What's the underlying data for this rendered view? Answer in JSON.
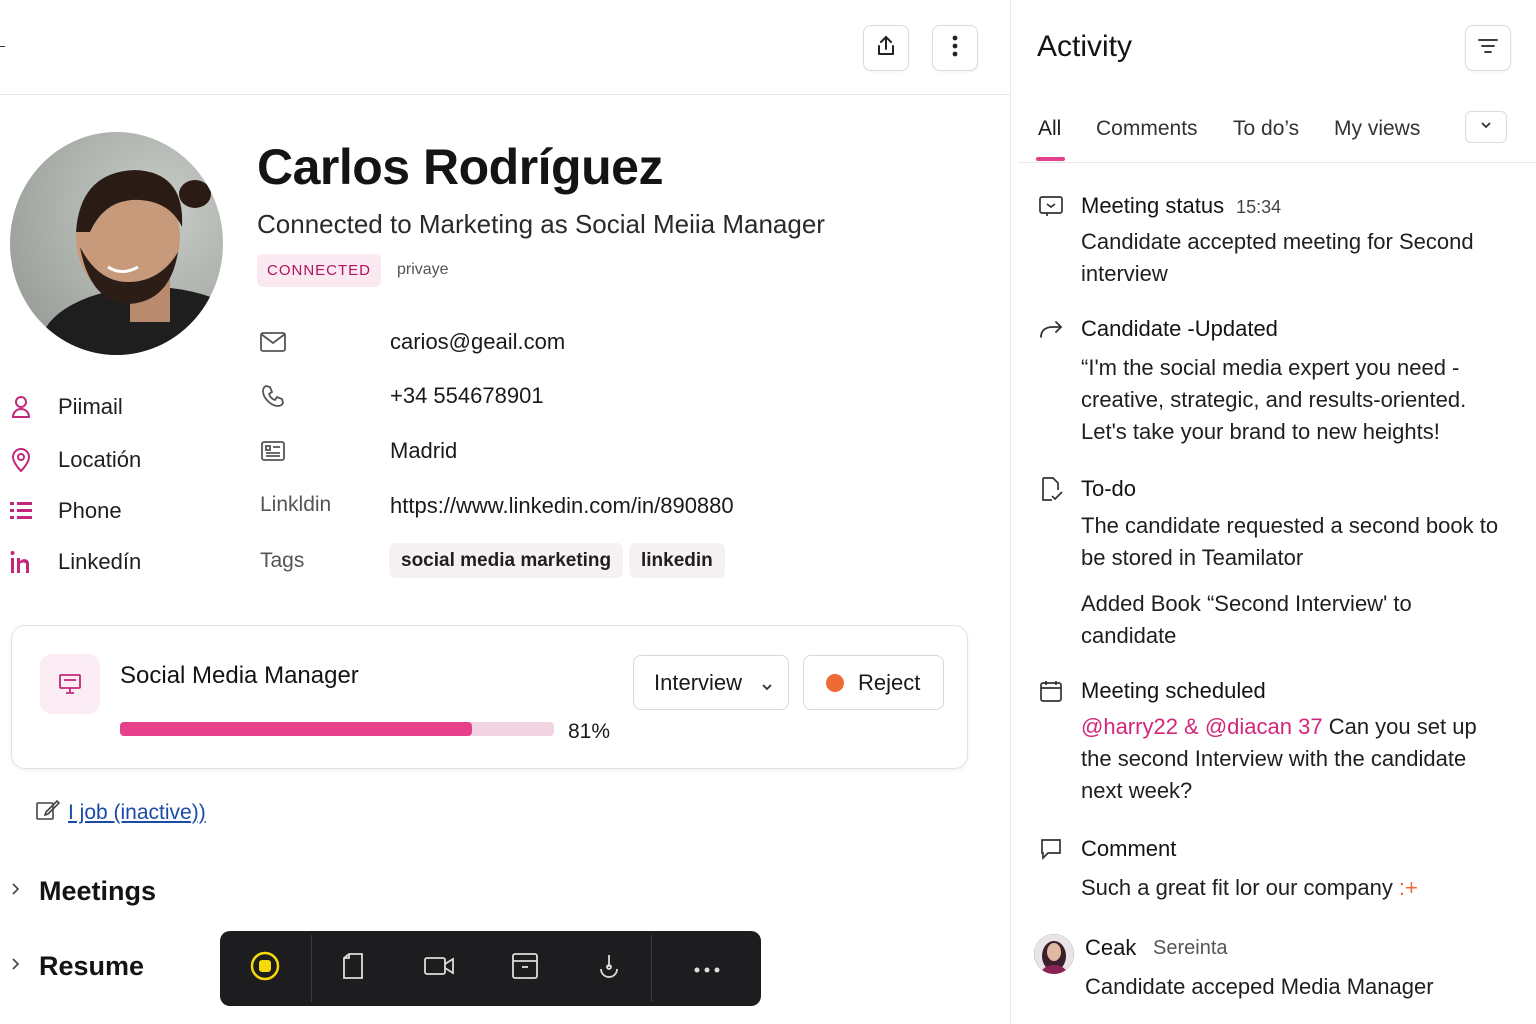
{
  "header": {
    "share_icon": "share-icon",
    "more_icon": "more-vertical-icon"
  },
  "profile": {
    "name": "Carlos Rodríguez",
    "subtitle": "Connected to Marketing as Social Meiia Manager",
    "status_badge": "CONNECTED",
    "privacy": "privaye"
  },
  "side_nav": [
    {
      "label": "Piimail",
      "icon": "user-icon"
    },
    {
      "label": "Locatión",
      "icon": "location-pin-icon"
    },
    {
      "label": "Phone",
      "icon": "list-icon"
    },
    {
      "label": "Linkedín",
      "icon": "linkedin-icon"
    }
  ],
  "details": {
    "email": "carios@geail.com",
    "phone": "+34 554678901",
    "city": "Madrid",
    "linkedin_key": "Linkldin",
    "linkedin_url": "https://www.linkedin.com/in/890880",
    "tags_key": "Tags",
    "tags": [
      "social media marketing",
      "linkedin"
    ]
  },
  "job": {
    "title": "Social Media Manager",
    "progress_pct": 81,
    "progress_label": "81%",
    "stage": "Interview",
    "reject_label": "Reject",
    "inactive_link": "I job (inactive))"
  },
  "sections": {
    "meetings": "Meetings",
    "resume": "Resume"
  },
  "toolbar": {
    "items": [
      "record-icon",
      "document-icon",
      "video-icon",
      "archive-icon",
      "microphone-icon",
      "more-horizontal-icon"
    ]
  },
  "activity": {
    "title": "Activity",
    "tabs": [
      "All",
      "Comments",
      "To do’s",
      "My views"
    ],
    "active_tab": "All",
    "items": [
      {
        "icon": "meeting-status-icon",
        "head": "Meeting status",
        "time": "15:34",
        "body": "Candidate accepted meeting for Second interview"
      },
      {
        "icon": "forward-arrow-icon",
        "head": "Candidate -Updated",
        "body": "“I'm the social media expert you need - creative, strategic, and results-oriented. Let's take your brand to new heights!"
      },
      {
        "icon": "todo-check-icon",
        "head": "To-do",
        "body": "The candidate requested a second book to be stored in Teamilator",
        "body2": "Added Book “Second Interview' to candidate"
      },
      {
        "icon": "calendar-icon",
        "head": "Meeting scheduled",
        "mention": "@harry22 & @diacan 37",
        "body": " Can you set up the second Interview with the candidate next week?"
      },
      {
        "icon": "comment-icon",
        "head": "Comment",
        "body": "Such a great fit lor our company",
        "sparkle": ":+"
      }
    ],
    "user_comment": {
      "name": "Ceak",
      "sub": "Sereinta",
      "message": "Candidate acceped Media Manager"
    }
  },
  "colors": {
    "accent": "#e6408a",
    "badge_bg": "#fbe9f2",
    "badge_text": "#b0145f",
    "reject": "#ef6a35",
    "link": "#1a4ba8"
  }
}
